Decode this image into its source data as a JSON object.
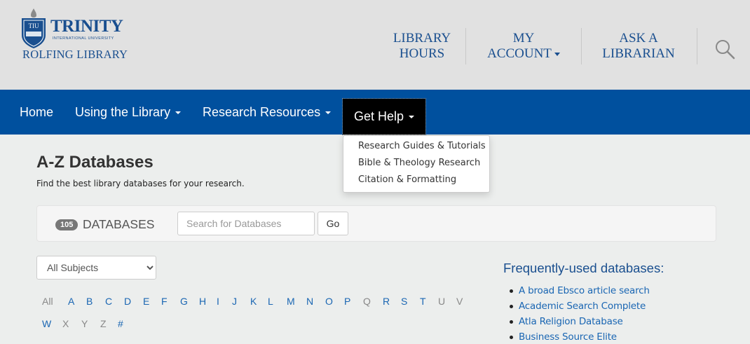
{
  "header": {
    "logo_word": "TRINITY",
    "logo_sub": "INTERNATIONAL UNIVERSITY",
    "logo_seal_text": "TIU",
    "library_name": "ROLFING LIBRARY",
    "nav": {
      "hours_line1": "LIBRARY",
      "hours_line2": "HOURS",
      "account_line1": "MY",
      "account_line2": "ACCOUNT",
      "ask_line1": "ASK A",
      "ask_line2": "LIBRARIAN"
    },
    "search_icon": "search-icon"
  },
  "navbar": {
    "items": [
      {
        "label": "Home"
      },
      {
        "label": "Using the Library"
      },
      {
        "label": "Research Resources"
      },
      {
        "label": "Get Help"
      }
    ],
    "dropdown": [
      {
        "label": "Research Guides & Tutorials"
      },
      {
        "label": "Bible & Theology Research"
      },
      {
        "label": "Citation & Formatting"
      }
    ]
  },
  "main": {
    "title": "A-Z Databases",
    "description": "Find the best library databases for your research.",
    "count": "105",
    "count_label": "DATABASES",
    "search_placeholder": "Search for Databases",
    "go_label": "Go",
    "subject_selected": "All Subjects",
    "letters_row1": [
      "All",
      "A",
      "B",
      "C",
      "D",
      "E",
      "F",
      "G",
      "H",
      "I",
      "J",
      "K",
      "L",
      "M",
      "N",
      "O",
      "P",
      "Q",
      "R",
      "S",
      "T",
      "U",
      "V"
    ],
    "letters_row2": [
      "W",
      "X",
      "Y",
      "Z",
      "#"
    ],
    "frequent_title": "Frequently-used databases:",
    "frequent": [
      {
        "label": "A broad Ebsco article search"
      },
      {
        "label": "Academic Search Complete"
      },
      {
        "label": "Atla Religion Database"
      },
      {
        "label": "Business Source Elite"
      }
    ]
  },
  "colors": {
    "brand_blue": "#00509e",
    "header_bg": "#e1e1e1",
    "page_bg": "#eceeed",
    "link_blue": "#1a66b3"
  }
}
